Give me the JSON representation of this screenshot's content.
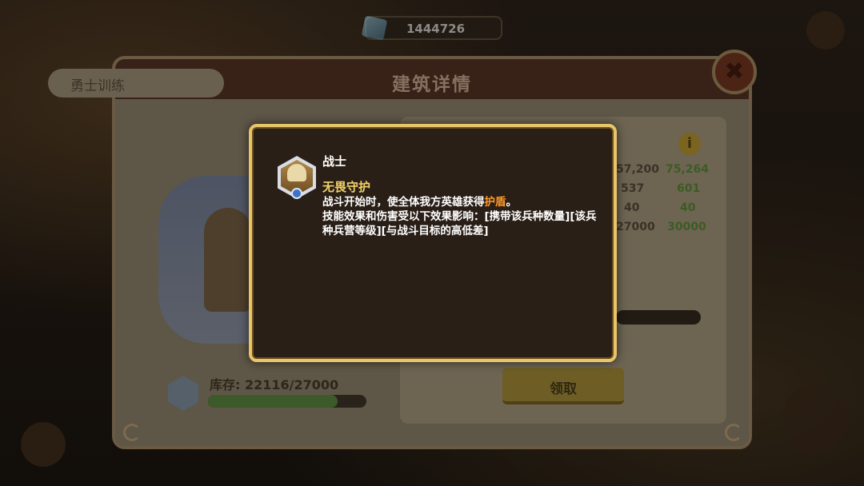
{
  "hud": {
    "currency_amount": "1444726"
  },
  "panel": {
    "title": "建筑详情",
    "close_symbol": "✖",
    "barracks_tab_label": "勇士训练",
    "stock_label": "库存: 22116/27000",
    "stock_fraction": 0.819,
    "info_symbol": "i",
    "stats": [
      {
        "old": "57,200",
        "new": "75,264"
      },
      {
        "old": "537",
        "new": "601"
      },
      {
        "old": "40",
        "new": "40"
      },
      {
        "old": "27000",
        "new": "30000"
      }
    ],
    "claim_button_label": "领取"
  },
  "tooltip": {
    "troop_name": "战士",
    "skill_name": "无畏守护",
    "desc_line1_prefix": "战斗开始时，使全体我方英雄获得",
    "desc_line1_keyword": "护盾",
    "desc_line1_suffix": "。",
    "desc_line2": "技能效果和伤害受以下效果影响：[携带该兵种数量][该兵种兵营等级][与战斗目标的高低差]"
  },
  "colors": {
    "tooltip_border": "#e8c46b",
    "keyword": "#ff9a2a",
    "skill_name": "#f3d36a"
  }
}
